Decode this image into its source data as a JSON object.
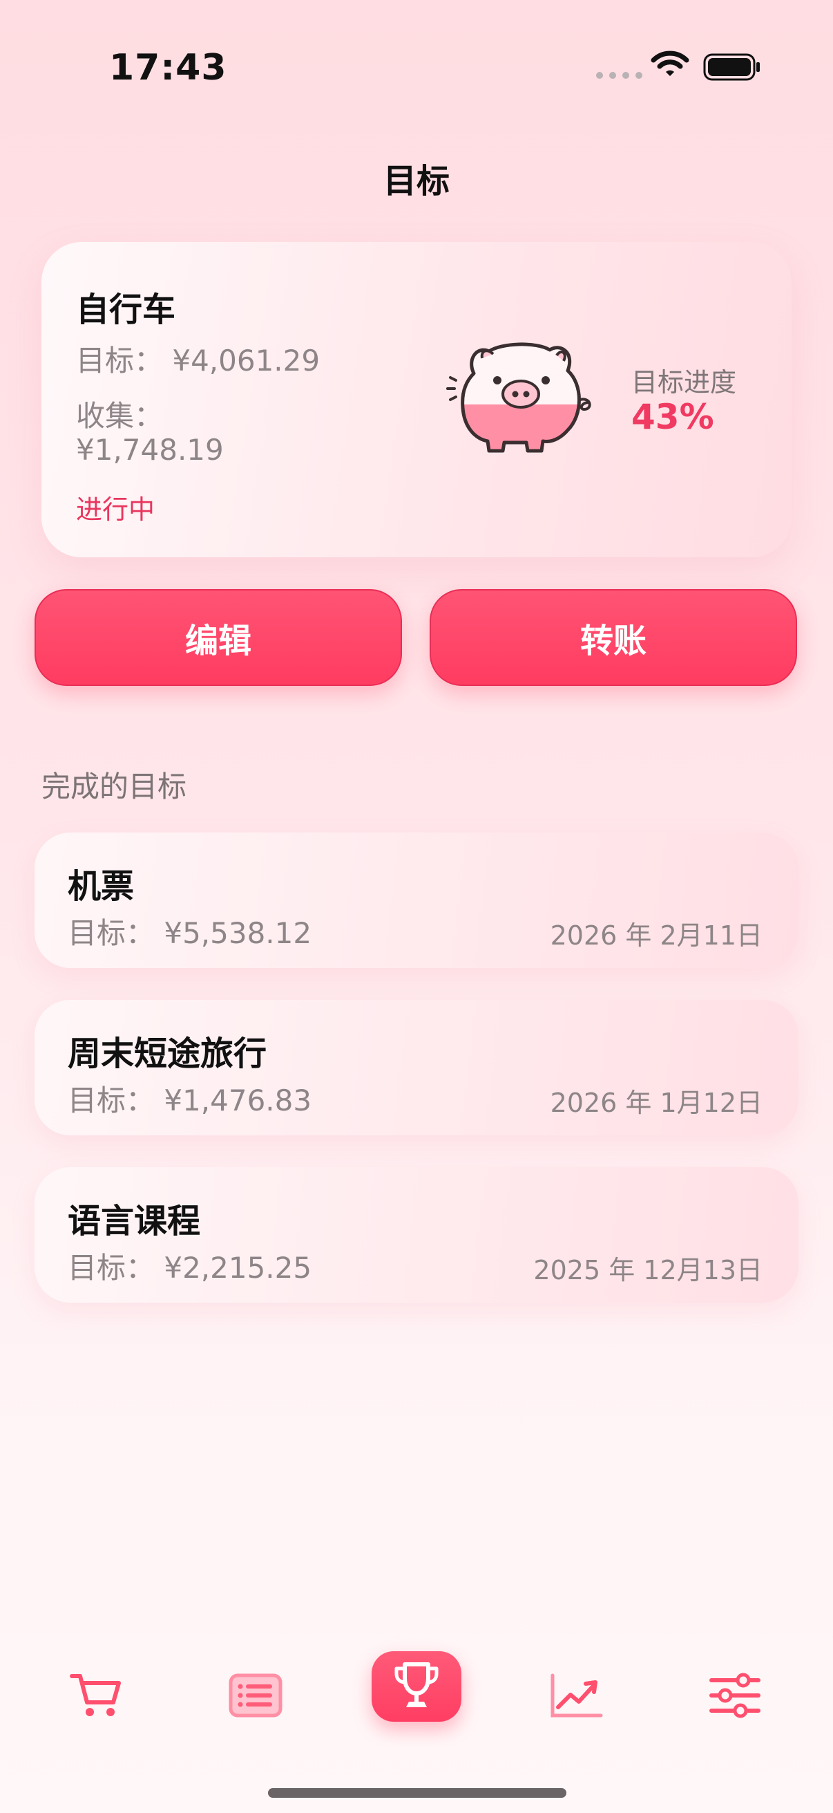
{
  "status_bar": {
    "time": "17:43"
  },
  "page": {
    "title": "目标"
  },
  "current_goal": {
    "name": "自行车",
    "target": "目标： ¥4,061.29",
    "collected_label": "收集：",
    "collected_value": "¥1,748.19",
    "status": "进行中",
    "progress_label": "目标进度",
    "progress_value": "43%",
    "progress_fraction": 0.43
  },
  "actions": {
    "edit_label": "编辑",
    "transfer_label": "转账"
  },
  "completed": {
    "section_title": "完成的目标",
    "items": [
      {
        "name": "机票",
        "target": "目标： ¥5,538.12",
        "date": "2026 年 2月11日"
      },
      {
        "name": "周末短途旅行",
        "target": "目标： ¥1,476.83",
        "date": "2026 年 1月12日"
      },
      {
        "name": "语言课程",
        "target": "目标： ¥2,215.25",
        "date": "2025 年 12月13日"
      }
    ]
  },
  "tab_bar": {
    "tabs": [
      {
        "icon": "cart-icon"
      },
      {
        "icon": "list-icon"
      },
      {
        "icon": "trophy-icon",
        "active": true
      },
      {
        "icon": "chart-icon"
      },
      {
        "icon": "sliders-icon"
      }
    ]
  },
  "colors": {
    "accent": "#FF3E63",
    "status": "#E8365E"
  }
}
